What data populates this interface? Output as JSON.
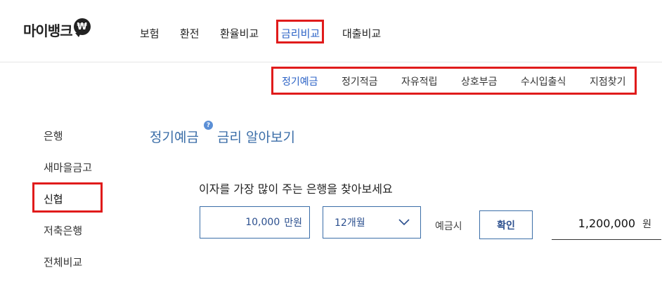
{
  "logo": {
    "text": "마이뱅크",
    "badge": "₩"
  },
  "gnb": {
    "items": [
      "보험",
      "환전",
      "환율비교",
      "금리비교",
      "대출비교"
    ],
    "active": "금리비교"
  },
  "subnav": {
    "items": [
      "정기예금",
      "정기적금",
      "자유적립",
      "상호부금",
      "수시입출식",
      "지점찾기"
    ],
    "active": "정기예금"
  },
  "side": {
    "items": [
      "은행",
      "새마을금고",
      "신협",
      "저축은행",
      "전체비교"
    ],
    "active": "신협"
  },
  "main": {
    "title_prefix": "정기예금",
    "title_suffix": "금리 알아보기",
    "help": "?",
    "question": "이자를 가장 많이 주는 은행을 찾아보세요"
  },
  "form": {
    "amount_value": "10,000",
    "amount_unit": "만원",
    "period_value": "12개월",
    "deposit_label": "예금시",
    "confirm_label": "확인",
    "result_value": "1,200,000",
    "result_unit": "원"
  },
  "colors": {
    "accent": "#2b62c6",
    "highlight_box": "#e01b1b",
    "title": "#3b6ea8"
  }
}
